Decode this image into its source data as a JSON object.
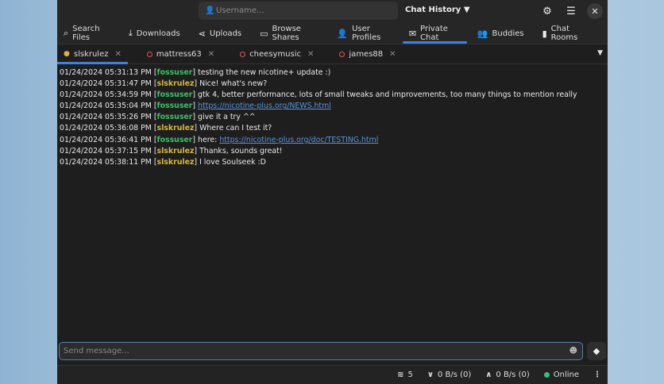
{
  "header": {
    "username_placeholder": "Username...",
    "chat_history": "Chat History"
  },
  "nav": [
    {
      "label": "Search Files",
      "icon": "⌕"
    },
    {
      "label": "Downloads",
      "icon": "⤓"
    },
    {
      "label": "Uploads",
      "icon": "⋖"
    },
    {
      "label": "Browse Shares",
      "icon": "▭"
    },
    {
      "label": "User Profiles",
      "icon": "👤"
    },
    {
      "label": "Private Chat",
      "icon": "✉"
    },
    {
      "label": "Buddies",
      "icon": "👥"
    },
    {
      "label": "Chat Rooms",
      "icon": "▮"
    }
  ],
  "chat_tabs": [
    "slskrulez",
    "mattress63",
    "cheesymusic",
    "james88"
  ],
  "messages": [
    {
      "t": "01/24/2024 05:31:13 PM",
      "u": "fossuser",
      "c": "g",
      "m": "testing the new nicotine+ update :)"
    },
    {
      "t": "01/24/2024 05:31:47 PM",
      "u": "slskrulez",
      "c": "y",
      "m": "Nice! what's new?"
    },
    {
      "t": "01/24/2024 05:34:59 PM",
      "u": "fossuser",
      "c": "g",
      "m": "gtk 4, better performance, lots of small tweaks and improvements, too many things to mention really"
    },
    {
      "t": "01/24/2024 05:35:04 PM",
      "u": "fossuser",
      "c": "g",
      "m": "",
      "link": "https://nicotine-plus.org/NEWS.html"
    },
    {
      "t": "01/24/2024 05:35:26 PM",
      "u": "fossuser",
      "c": "g",
      "m": "give it a try ^^"
    },
    {
      "t": "01/24/2024 05:36:08 PM",
      "u": "slskrulez",
      "c": "y",
      "m": "Where can I test it?"
    },
    {
      "t": "01/24/2024 05:36:41 PM",
      "u": "fossuser",
      "c": "g",
      "m": "here: ",
      "link": "https://nicotine-plus.org/doc/TESTING.html"
    },
    {
      "t": "01/24/2024 05:37:15 PM",
      "u": "slskrulez",
      "c": "y",
      "m": "Thanks, sounds great!"
    },
    {
      "t": "01/24/2024 05:38:11 PM",
      "u": "slskrulez",
      "c": "y",
      "m": "I love Soulseek :D"
    }
  ],
  "input": {
    "placeholder": "Send message..."
  },
  "status": {
    "connections": "5",
    "down": "0 B/s (0)",
    "up": "0 B/s (0)",
    "online": "Online"
  }
}
